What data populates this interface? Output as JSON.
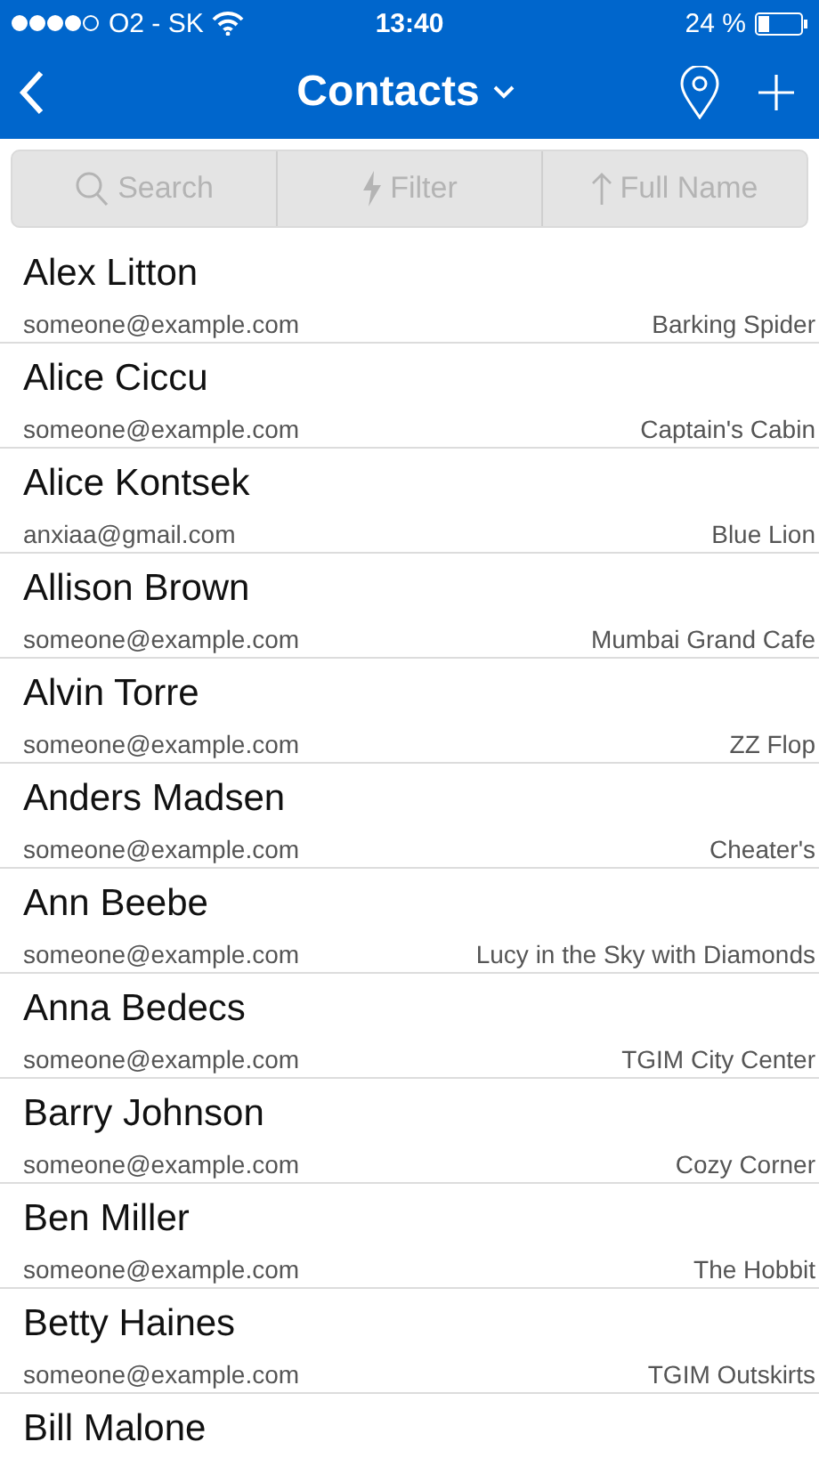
{
  "status_bar": {
    "carrier": "O2 - SK",
    "time": "13:40",
    "battery": "24 %"
  },
  "nav": {
    "title": "Contacts"
  },
  "toolbar": [
    {
      "kind": "search",
      "label": "Search"
    },
    {
      "kind": "filter",
      "label": "Filter"
    },
    {
      "kind": "sort",
      "label": "Full Name"
    }
  ],
  "contacts": [
    {
      "name": "Alex Litton",
      "email": "someone@example.com",
      "company": "Barking Spider"
    },
    {
      "name": "Alice Ciccu",
      "email": "someone@example.com",
      "company": "Captain's Cabin"
    },
    {
      "name": "Alice Kontsek",
      "email": "anxiaa@gmail.com",
      "company": "Blue Lion"
    },
    {
      "name": "Allison Brown",
      "email": "someone@example.com",
      "company": "Mumbai Grand Cafe"
    },
    {
      "name": "Alvin Torre",
      "email": "someone@example.com",
      "company": "ZZ Flop"
    },
    {
      "name": "Anders Madsen",
      "email": "someone@example.com",
      "company": "Cheater's"
    },
    {
      "name": "Ann Beebe",
      "email": "someone@example.com",
      "company": "Lucy in the Sky with Diamonds"
    },
    {
      "name": "Anna Bedecs",
      "email": "someone@example.com",
      "company": "TGIM City Center"
    },
    {
      "name": "Barry Johnson",
      "email": "someone@example.com",
      "company": "Cozy Corner"
    },
    {
      "name": "Ben Miller",
      "email": "someone@example.com",
      "company": "The Hobbit"
    },
    {
      "name": "Betty Haines",
      "email": "someone@example.com",
      "company": "TGIM Outskirts"
    },
    {
      "name": "Bill Malone"
    }
  ]
}
